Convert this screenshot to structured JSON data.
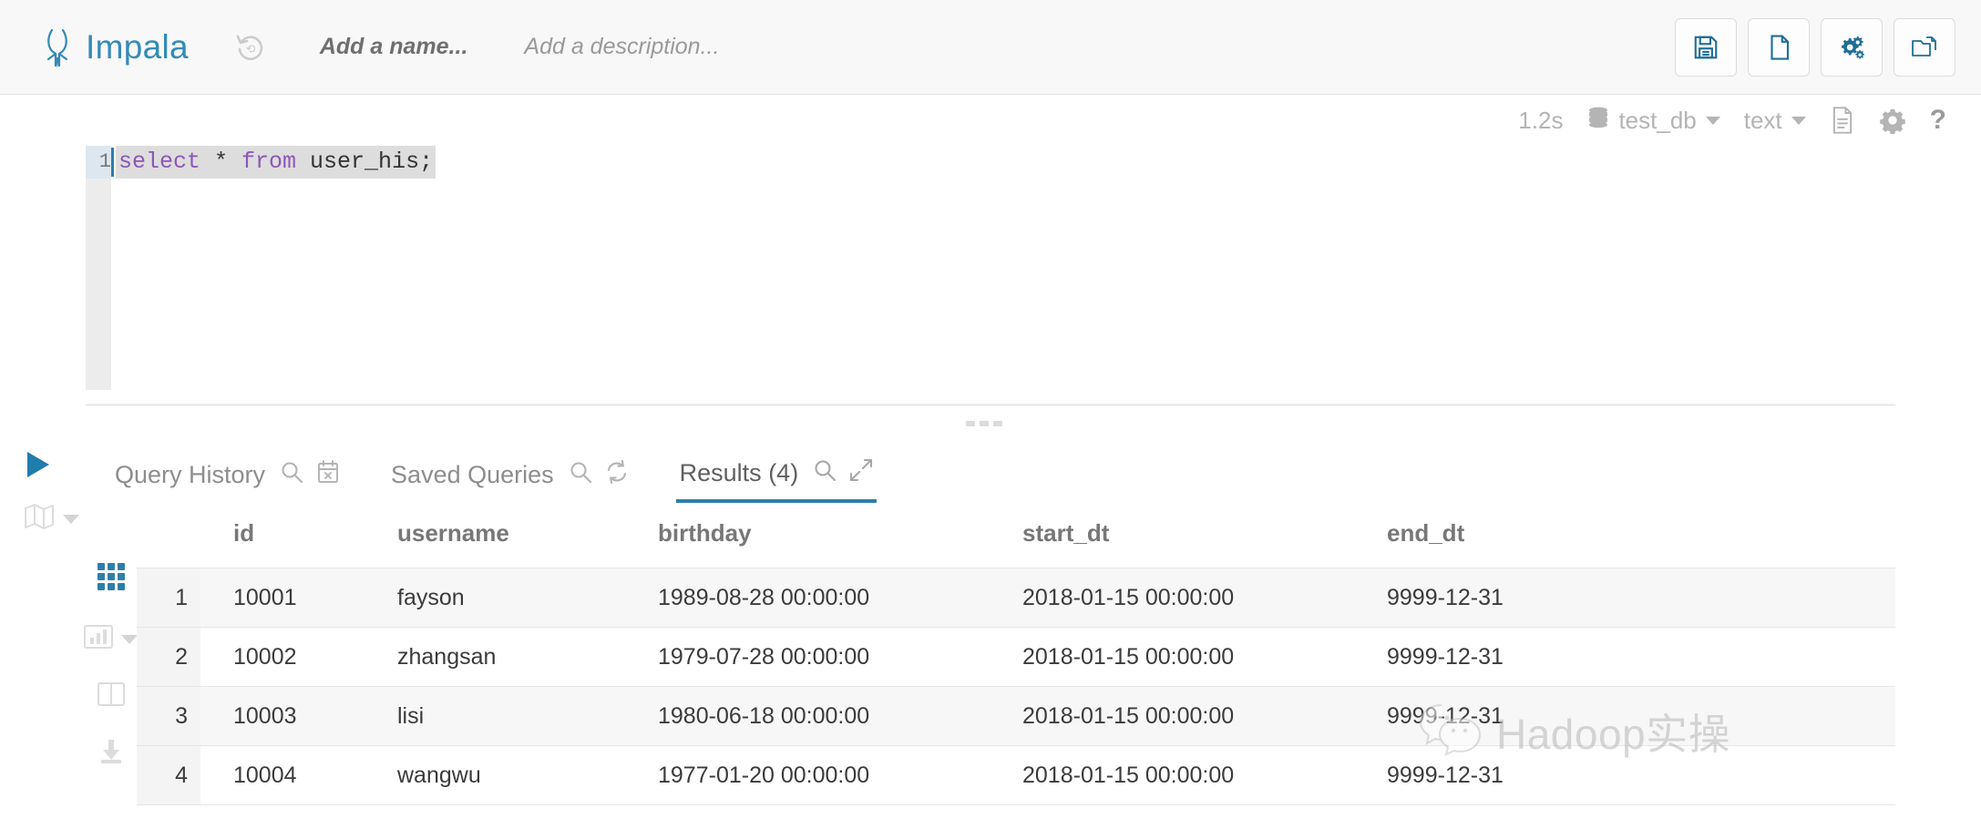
{
  "header": {
    "app_title": "Impala",
    "logo_icon": "impala-antelope-logo",
    "history_icon": "history-revert-icon",
    "doc_name_placeholder": "Add a name...",
    "doc_description_placeholder": "Add a description...",
    "actions": [
      {
        "name": "save-button",
        "icon": "floppy-save-icon"
      },
      {
        "name": "new-query-button",
        "icon": "new-document-icon"
      },
      {
        "name": "settings-button",
        "icon": "gears-settings-icon"
      },
      {
        "name": "open-query-button",
        "icon": "open-folder-icon"
      }
    ]
  },
  "editor_meta": {
    "duration": "1.2s",
    "database_icon": "database-stack-icon",
    "database": "test_db",
    "format": "text",
    "file_icon": "document-lines-icon",
    "gear_icon": "gear-icon",
    "help_icon": "question-mark-icon"
  },
  "editor": {
    "line_number": "1",
    "code_tokens": [
      {
        "text": "select",
        "type": "keyword"
      },
      {
        "text": " * ",
        "type": "plain"
      },
      {
        "text": "from",
        "type": "keyword"
      },
      {
        "text": " user_his;",
        "type": "plain"
      }
    ],
    "code_plain": "select * from user_his;",
    "run_icon": "play-run-icon",
    "explain_icon": "map-explain-icon"
  },
  "tabs": [
    {
      "label": "Query History",
      "active": false,
      "icons": [
        "search-icon",
        "calendar-clear-icon"
      ]
    },
    {
      "label": "Saved Queries",
      "active": false,
      "icons": [
        "search-icon",
        "refresh-icon"
      ]
    },
    {
      "label": "Results (4)",
      "active": true,
      "icons": [
        "search-icon",
        "expand-arrows-icon"
      ]
    }
  ],
  "result_tools": [
    {
      "name": "grid-view-button",
      "icon": "grid-icon",
      "active": true
    },
    {
      "name": "chart-view-button",
      "icon": "bar-chart-icon",
      "active": false,
      "has_caret": true
    },
    {
      "name": "columns-view-button",
      "icon": "columns-icon",
      "active": false
    },
    {
      "name": "download-button",
      "icon": "download-icon",
      "active": false
    }
  ],
  "results": {
    "columns": [
      "id",
      "username",
      "birthday",
      "start_dt",
      "end_dt"
    ],
    "rows": [
      {
        "n": "1",
        "id": "10001",
        "username": "fayson",
        "birthday": "1989-08-28 00:00:00",
        "start_dt": "2018-01-15 00:00:00",
        "end_dt": "9999-12-31"
      },
      {
        "n": "2",
        "id": "10002",
        "username": "zhangsan",
        "birthday": "1979-07-28 00:00:00",
        "start_dt": "2018-01-15 00:00:00",
        "end_dt": "9999-12-31"
      },
      {
        "n": "3",
        "id": "10003",
        "username": "lisi",
        "birthday": "1980-06-18 00:00:00",
        "start_dt": "2018-01-15 00:00:00",
        "end_dt": "9999-12-31"
      },
      {
        "n": "4",
        "id": "10004",
        "username": "wangwu",
        "birthday": "1977-01-20 00:00:00",
        "start_dt": "2018-01-15 00:00:00",
        "end_dt": "9999-12-31"
      }
    ]
  },
  "watermark": {
    "icon": "wechat-bubbles-logo",
    "text": "Hadoop实操"
  },
  "colors": {
    "accent": "#2e7fa8",
    "brand": "#338bb8",
    "keyword": "#8d56b8",
    "muted": "#b4b4b4",
    "row_stripe": "#f7f7f7"
  }
}
